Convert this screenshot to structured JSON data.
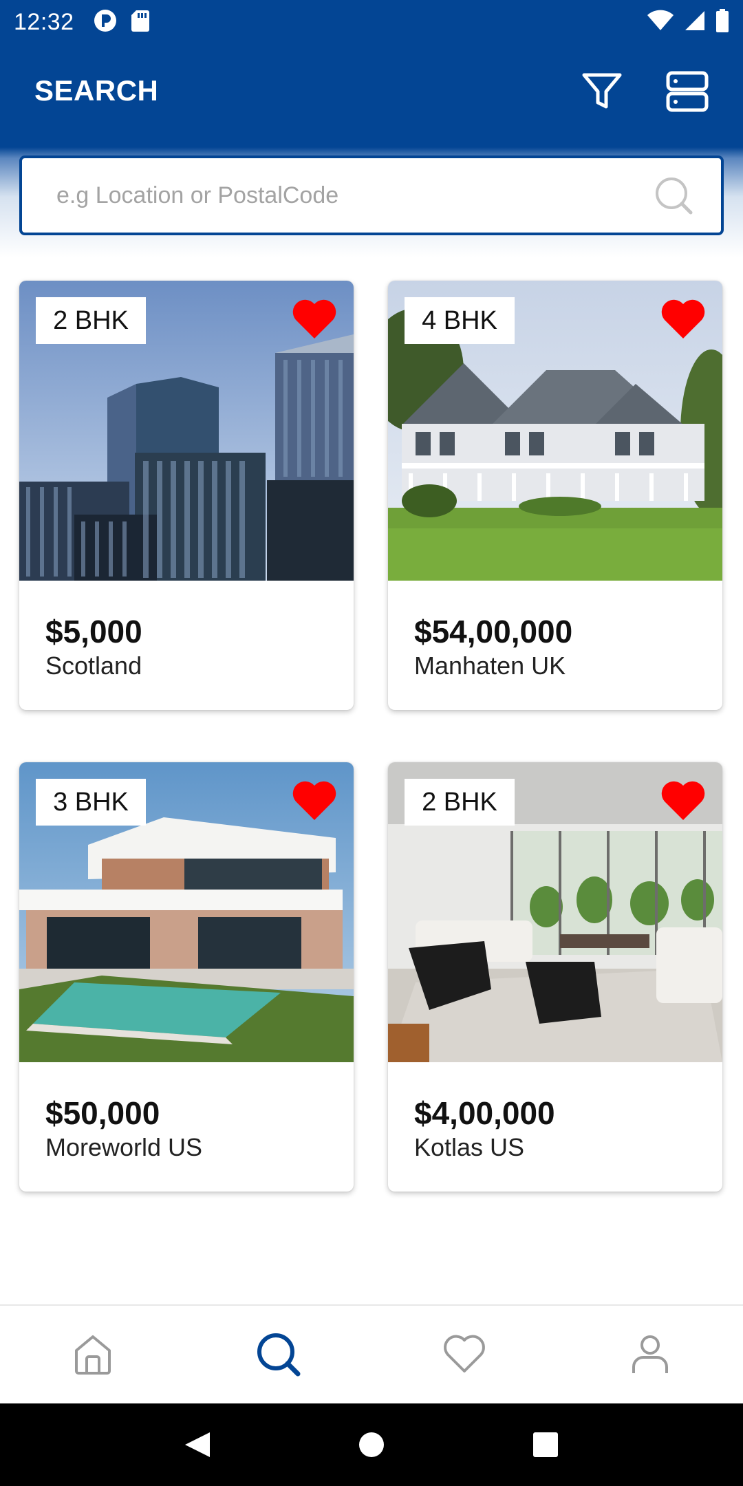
{
  "status_bar": {
    "time": "12:32"
  },
  "app_bar": {
    "title": "SEARCH",
    "filter_icon": "filter-icon",
    "layout_icon": "list-layout-icon"
  },
  "search": {
    "placeholder": "e.g Location or PostalCode",
    "value": ""
  },
  "listings": [
    {
      "bhk": "2 BHK",
      "price": "$5,000",
      "location": "Scotland",
      "favorited": true
    },
    {
      "bhk": "4 BHK",
      "price": "$54,00,000",
      "location": "Manhaten UK",
      "favorited": true
    },
    {
      "bhk": "3 BHK",
      "price": "$50,000",
      "location": "Moreworld US",
      "favorited": true
    },
    {
      "bhk": "2 BHK",
      "price": "$4,00,000",
      "location": "Kotlas US",
      "favorited": true
    }
  ],
  "bottom_nav": {
    "items": [
      {
        "icon": "home-icon",
        "active": false
      },
      {
        "icon": "search-icon",
        "active": true
      },
      {
        "icon": "heart-icon",
        "active": false
      },
      {
        "icon": "profile-icon",
        "active": false
      }
    ]
  },
  "colors": {
    "primary": "#034594",
    "favorite": "#ff0000",
    "inactive_icon": "#9a9a9a"
  }
}
